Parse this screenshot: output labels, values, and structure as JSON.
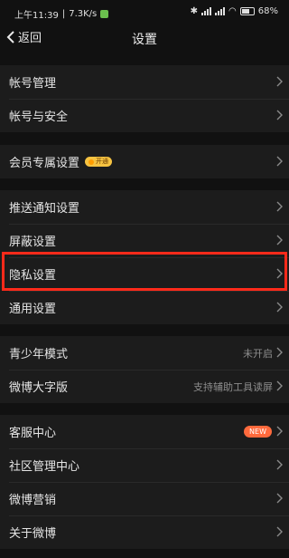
{
  "status_bar": {
    "time": "上午11:39",
    "net_speed": "7.3K/s",
    "battery": "68"
  },
  "nav": {
    "back_label": "返回",
    "title": "设置"
  },
  "groups": [
    {
      "items": [
        {
          "label": "帐号管理"
        },
        {
          "label": "帐号与安全"
        }
      ]
    },
    {
      "items": [
        {
          "label": "会员专属设置",
          "badge": "开通"
        }
      ]
    },
    {
      "items": [
        {
          "label": "推送通知设置"
        },
        {
          "label": "屏蔽设置"
        },
        {
          "label": "隐私设置"
        },
        {
          "label": "通用设置"
        }
      ]
    },
    {
      "items": [
        {
          "label": "青少年模式",
          "value": "未开启"
        },
        {
          "label": "微博大字版",
          "value": "支持辅助工具读屏"
        }
      ]
    },
    {
      "items": [
        {
          "label": "客服中心",
          "badge": "NEW"
        },
        {
          "label": "社区管理中心"
        },
        {
          "label": "微博营销"
        },
        {
          "label": "关于微博"
        }
      ]
    }
  ],
  "colors": {
    "background": "#111111",
    "row_background": "#1c1c1c",
    "highlight_border": "#ff2a1a",
    "new_badge": "#ff6a3d"
  }
}
